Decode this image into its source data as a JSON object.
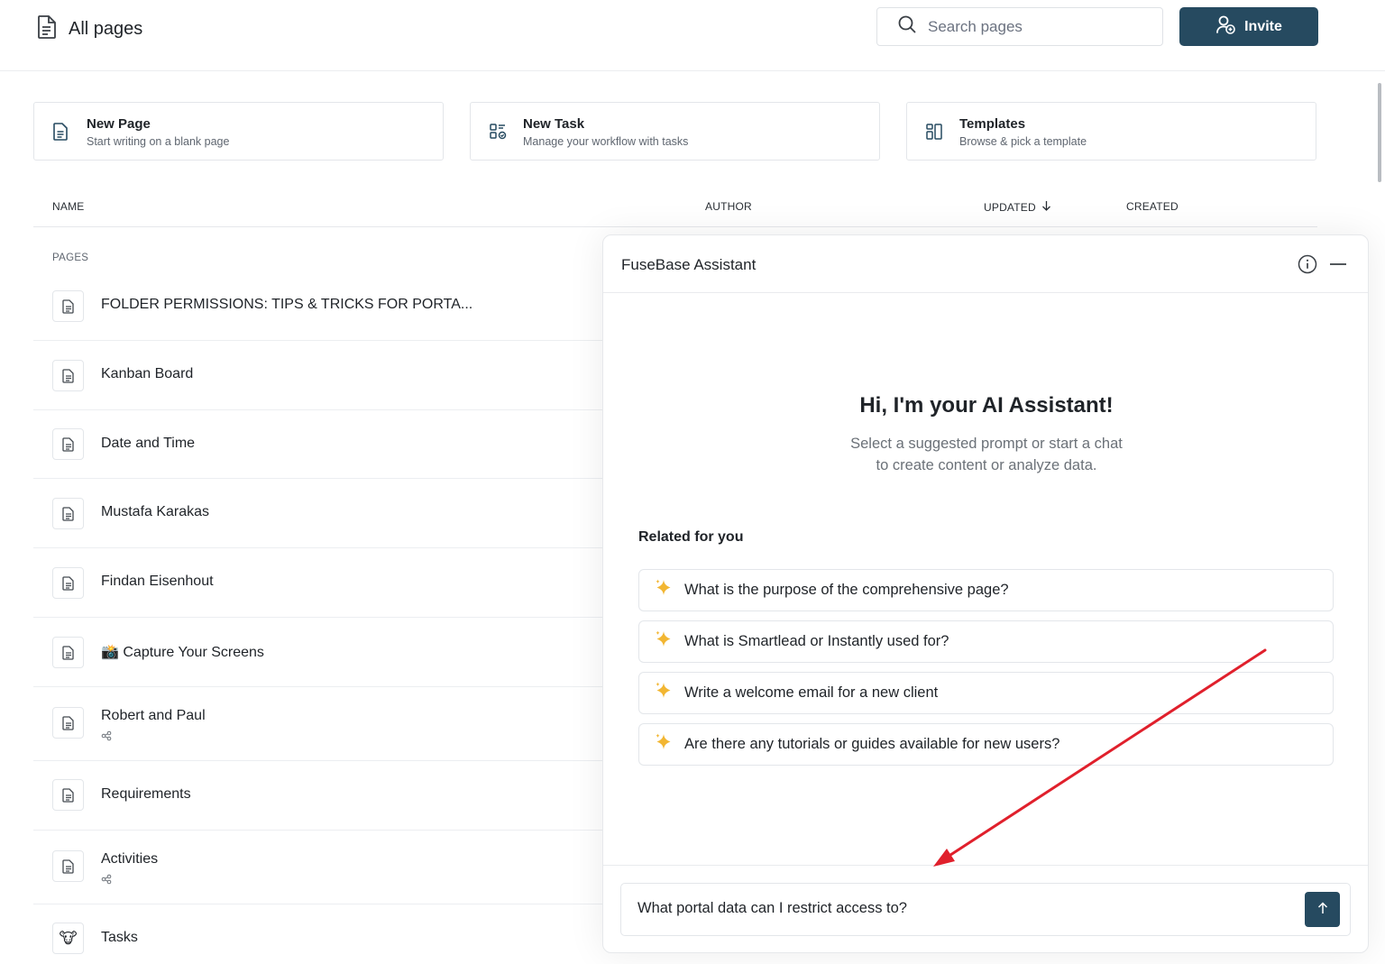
{
  "header": {
    "title": "All pages",
    "search_placeholder": "Search pages",
    "invite_label": "Invite"
  },
  "cards": [
    {
      "title": "New Page",
      "subtitle": "Start writing on a blank page",
      "icon": "page-icon"
    },
    {
      "title": "New Task",
      "subtitle": "Manage your workflow with tasks",
      "icon": "task-icon"
    },
    {
      "title": "Templates",
      "subtitle": "Browse & pick a template",
      "icon": "templates-icon"
    }
  ],
  "table": {
    "columns": {
      "name": "NAME",
      "author": "AUTHOR",
      "updated": "UPDATED",
      "created": "CREATED"
    },
    "section_label": "PAGES",
    "rows": [
      {
        "name": "FOLDER PERMISSIONS: TIPS & TRICKS FOR PORTA...",
        "icon": "document-icon"
      },
      {
        "name": "Kanban Board",
        "icon": "document-icon"
      },
      {
        "name": "Date and Time",
        "icon": "document-icon"
      },
      {
        "name": "Mustafa Karakas",
        "icon": "document-icon"
      },
      {
        "name": "Findan Eisenhout",
        "icon": "document-icon"
      },
      {
        "name": "📸 Capture Your Screens",
        "icon": "document-icon"
      },
      {
        "name": "Robert and Paul",
        "icon": "document-icon",
        "shared": true
      },
      {
        "name": "Requirements",
        "icon": "document-icon"
      },
      {
        "name": "Activities",
        "icon": "document-icon",
        "shared": true
      },
      {
        "name": "Tasks",
        "icon": "emoji-icon"
      }
    ]
  },
  "assistant": {
    "title": "FuseBase Assistant",
    "greeting": "Hi, I'm your AI Assistant!",
    "subtitle_line1": "Select a suggested prompt or start a chat",
    "subtitle_line2": "to create content or analyze data.",
    "related_label": "Related for you",
    "prompts": [
      "What is the purpose of the comprehensive page?",
      "What is Smartlead or Instantly used for?",
      "Write a welcome email for a new client",
      "Are there any tutorials or guides available for new users?"
    ],
    "input_value": "What portal data can I restrict access to?"
  },
  "colors": {
    "accent": "#264a60",
    "arrow": "#e0202c",
    "sparkle": "#f2b632"
  }
}
